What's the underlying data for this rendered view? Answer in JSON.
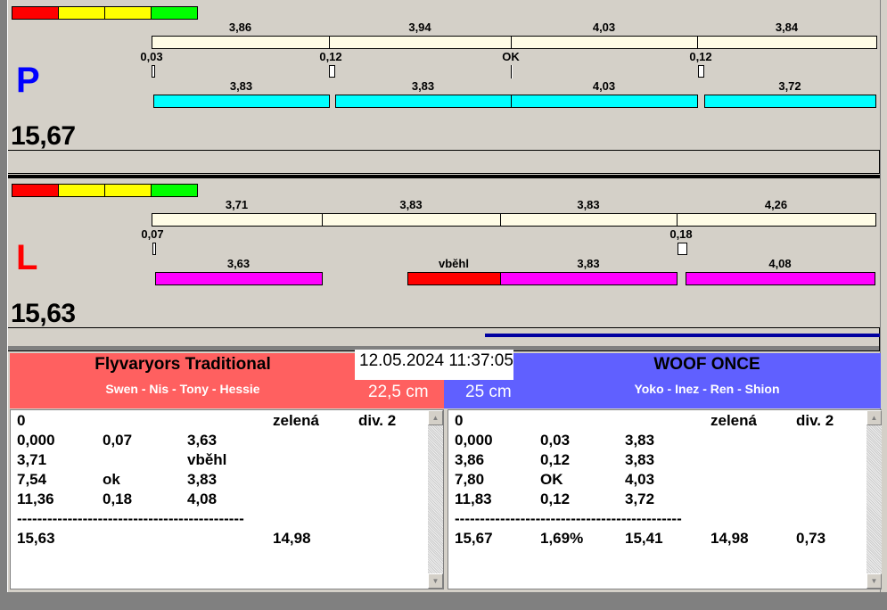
{
  "lanes": [
    {
      "letter": "P",
      "letter_color": "#0000ff",
      "total": "15,67",
      "splits": [
        "3,86",
        "3,94",
        "4,03",
        "3,84"
      ],
      "reactions": [
        "0,03",
        "0,12",
        "OK",
        "0,12"
      ],
      "times": [
        "3,83",
        "3,83",
        "4,03",
        "3,72"
      ],
      "time_color": "#00ffff"
    },
    {
      "letter": "L",
      "letter_color": "#ff0000",
      "total": "15,63",
      "splits": [
        "3,71",
        "3,83",
        "3,83",
        "4,26"
      ],
      "reactions": [
        "0,07",
        "0,18"
      ],
      "times": [
        "3,63",
        "vběhl",
        "3,83",
        "4,08"
      ],
      "time_color": "#ff00ff",
      "fault_color": "#ff0000"
    }
  ],
  "progress_fraction": 0.54,
  "datetime": "12.05.2024 11:37:05",
  "teams": [
    {
      "name": "Flyvaryors Traditional",
      "members": "Swen - Nis - Tony - Hessie",
      "height": "22,5 cm",
      "color": "#ff6060",
      "rows": [
        [
          "0",
          "",
          "",
          "zelená",
          "div. 2"
        ],
        [
          "0,000",
          "0,07",
          "3,63",
          "",
          ""
        ],
        [
          "3,71",
          "",
          "vběhl",
          "",
          ""
        ],
        [
          "7,54",
          "ok",
          "3,83",
          "",
          ""
        ],
        [
          "11,36",
          "0,18",
          "4,08",
          "",
          ""
        ],
        [
          "---------------------------------------------",
          "",
          "",
          "",
          ""
        ],
        [
          "15,63",
          "",
          "",
          "14,98",
          ""
        ]
      ]
    },
    {
      "name": "WOOF ONCE",
      "members": "Yoko - Inez - Ren - Shion",
      "height": "25 cm",
      "color": "#6060ff",
      "rows": [
        [
          "0",
          "",
          "",
          "zelená",
          "div. 2"
        ],
        [
          "0,000",
          "0,03",
          "3,83",
          "",
          ""
        ],
        [
          "3,86",
          "0,12",
          "3,83",
          "",
          ""
        ],
        [
          "7,80",
          "OK",
          "4,03",
          "",
          ""
        ],
        [
          "11,83",
          "0,12",
          "3,72",
          "",
          ""
        ],
        [
          "---------------------------------------------",
          "",
          "",
          "",
          ""
        ],
        [
          "15,67",
          "1,69%",
          "15,41",
          "14,98",
          "0,73"
        ]
      ]
    }
  ]
}
